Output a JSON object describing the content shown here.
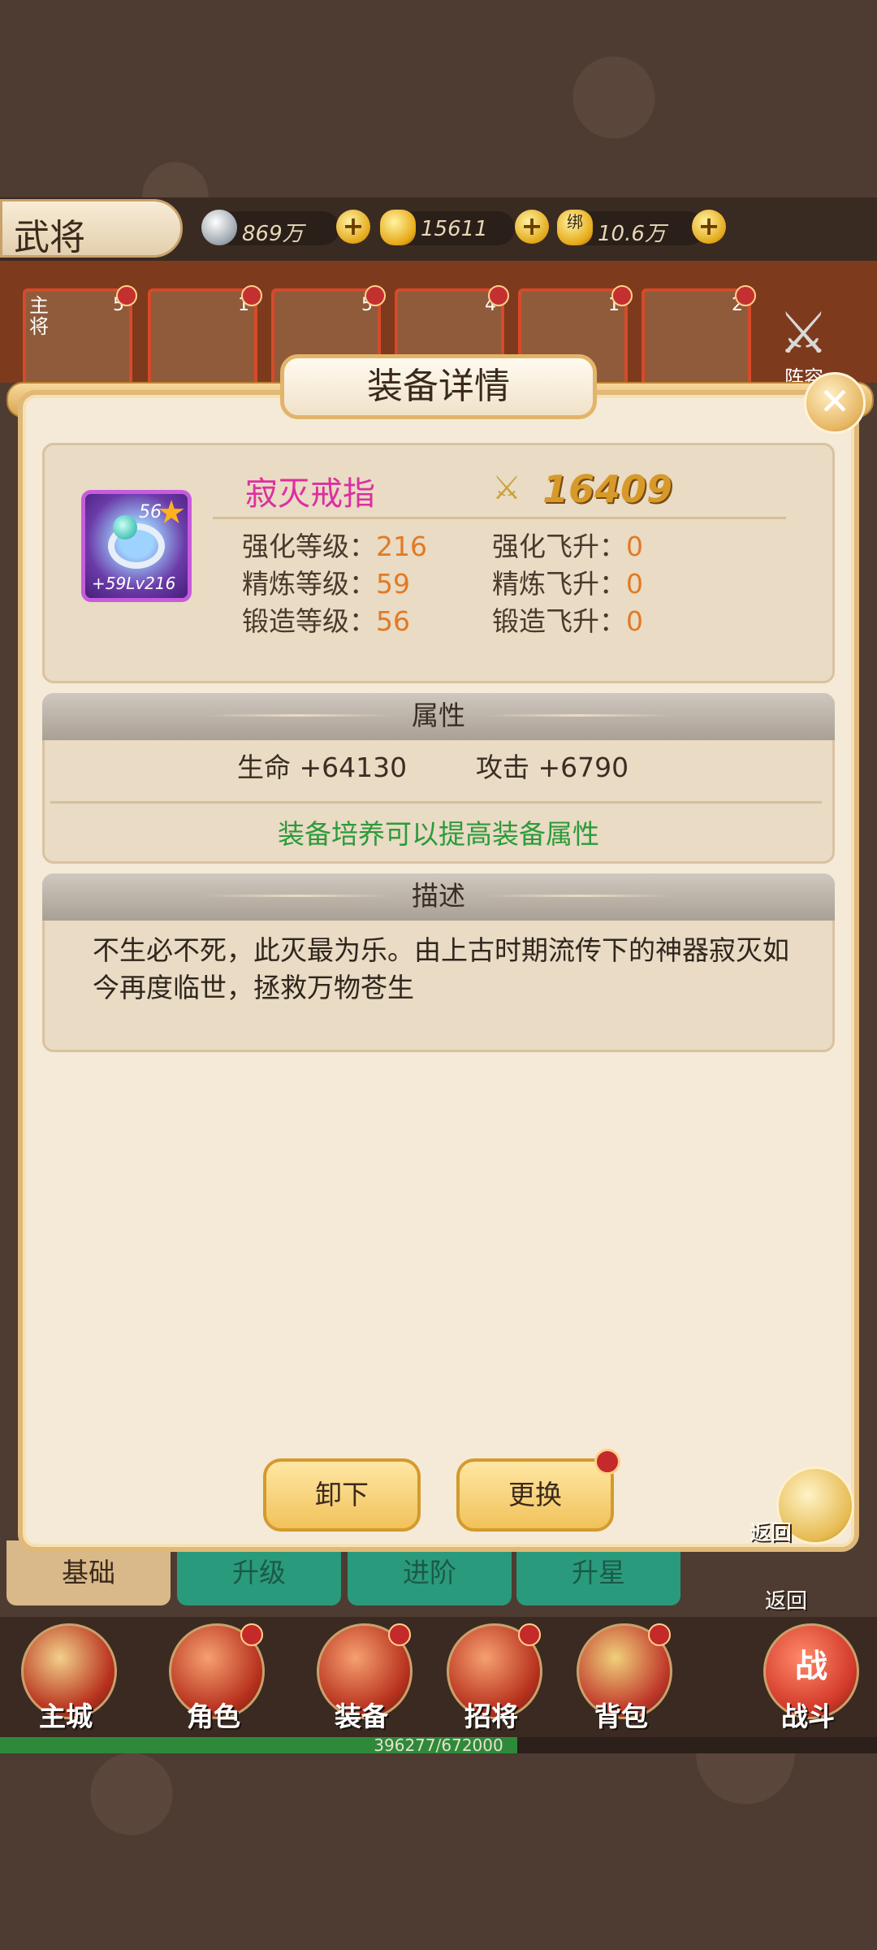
{
  "header": {
    "title": "武将",
    "resources": [
      {
        "icon": "silver-coin-icon",
        "value": "869万"
      },
      {
        "icon": "gold-ingot-icon",
        "value": "15611"
      },
      {
        "icon": "bound-gold-icon",
        "value": "10.6万",
        "tag": "绑"
      }
    ]
  },
  "hero_strip": {
    "main_label": "主将",
    "levels": [
      "5",
      "1",
      "5",
      "4",
      "1",
      "2"
    ],
    "formation_label": "阵容"
  },
  "modal": {
    "title": "装备详情",
    "item": {
      "name": "寂灭戒指",
      "power": "16409",
      "star_level": "56",
      "badge_sub": "+59Lv216",
      "stats": [
        {
          "label": "强化等级：",
          "value": "216"
        },
        {
          "label": "强化飞升：",
          "value": "0"
        },
        {
          "label": "精炼等级：",
          "value": "59"
        },
        {
          "label": "精炼飞升：",
          "value": "0"
        },
        {
          "label": "锻造等级：",
          "value": "56"
        },
        {
          "label": "锻造飞升：",
          "value": "0"
        }
      ]
    },
    "attributes": {
      "heading": "属性",
      "items": [
        {
          "label": "生命 +64130"
        },
        {
          "label": "攻击 +6790"
        }
      ],
      "note": "装备培养可以提高装备属性"
    },
    "description": {
      "heading": "描述",
      "text": "不生必不死，此灭最为乐。由上古时期流传下的神器寂灭如今再度临世，拯救万物苍生"
    },
    "buttons": {
      "unequip": "卸下",
      "replace": "更换",
      "back": "返回"
    }
  },
  "tabs": [
    "基础",
    "升级",
    "进阶",
    "升星"
  ],
  "back_label_2": "返回",
  "nav": {
    "items": [
      "主城",
      "角色",
      "装备",
      "招将",
      "背包",
      "战斗"
    ],
    "battle_tag": "战"
  },
  "xp": {
    "text": "396277/672000",
    "fraction": 0.59
  },
  "colors": {
    "item_name": "#dd2fa0",
    "stat_value": "#e17a24",
    "note_green": "#2c9a3a",
    "power_gold": "#d79a2a"
  }
}
